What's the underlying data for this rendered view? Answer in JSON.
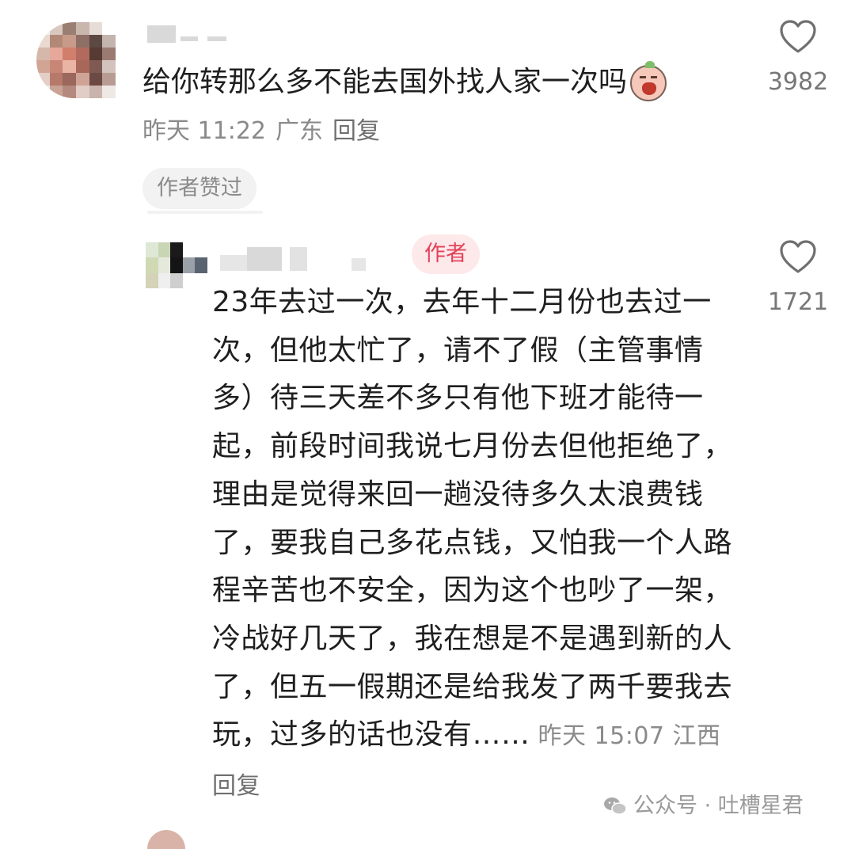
{
  "comment": {
    "username": "",
    "text": "给你转那么多不能去国外找人家一次吗",
    "emoji": "crying-peach-emoji",
    "time": "昨天 11:22",
    "location": "广东",
    "reply_label": "回复",
    "author_liked_label": "作者赞过",
    "like_count": "3982"
  },
  "reply": {
    "username": "",
    "author_badge": "作者",
    "text": "23年去过一次，去年十二月份也去过一次，但他太忙了，请不了假（主管事情多）待三天差不多只有他下班才能待一起，前段时间我说七月份去但他拒绝了，理由是觉得来回一趟没待多久太浪费钱了，要我自己多花点钱，又怕我一个人路程辛苦也不安全，因为这个也吵了一架，冷战好几天了，我在想是不是遇到新的人了，但五一假期还是给我发了两千要我去玩，过多的话也没有……",
    "time": "昨天 15:07",
    "location": "江西",
    "reply_label": "回复",
    "like_count": "1721"
  },
  "watermark": {
    "text": "公众号 · 吐槽星君"
  },
  "colors": {
    "text": "#1f1f1f",
    "meta": "#8a8a8a",
    "author_badge_text": "#e3435a",
    "author_badge_bg": "#fde8ea",
    "liked_bg": "#f2f2f2"
  }
}
